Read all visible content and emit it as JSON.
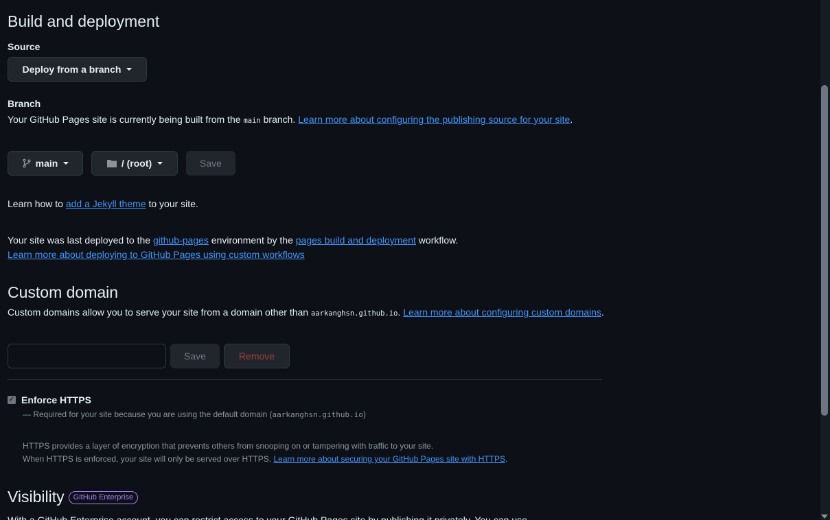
{
  "build": {
    "heading": "Build and deployment",
    "source_label": "Source",
    "source_dropdown": "Deploy from a branch",
    "branch_label": "Branch",
    "branch_desc_pre": "Your GitHub Pages site is currently being built from the ",
    "branch_desc_code": "main",
    "branch_desc_mid": " branch. ",
    "branch_desc_link": "Learn more about configuring the publishing source for your site",
    "branch_desc_end": ".",
    "branch_button": "main",
    "folder_button": "/ (root)",
    "save_button": "Save",
    "jekyll_pre": "Learn how to ",
    "jekyll_link": "add a Jekyll theme",
    "jekyll_post": " to your site.",
    "deploy_pre": "Your site was last deployed to the ",
    "deploy_env_link": "github-pages",
    "deploy_mid": " environment by the ",
    "deploy_workflow_link": "pages build and deployment",
    "deploy_post": " workflow.",
    "deploy_learn_link": "Learn more about deploying to GitHub Pages using custom workflows"
  },
  "custom_domain": {
    "heading": "Custom domain",
    "desc_pre": "Custom domains allow you to serve your site from a domain other than ",
    "desc_code": "aarkanghsn.github.io",
    "desc_mid": ". ",
    "desc_link": "Learn more about configuring custom domains",
    "desc_end": ".",
    "input_value": "",
    "input_placeholder": "",
    "save_button": "Save",
    "remove_button": "Remove"
  },
  "https": {
    "label": "Enforce HTTPS",
    "checked": true,
    "required_pre": "— Required for your site because you are using the default domain (",
    "required_code": "aarkanghsn.github.io",
    "required_post": ")",
    "info_line1": "HTTPS provides a layer of encryption that prevents others from snooping on or tampering with traffic to your site.",
    "info_line2_pre": "When HTTPS is enforced, your site will only be served over HTTPS. ",
    "info_line2_link": "Learn more about securing your GitHub Pages site with HTTPS",
    "info_line2_end": "."
  },
  "visibility": {
    "heading": "Visibility",
    "badge": "GitHub Enterprise",
    "desc_cut": "With a GitHub Enterprise account, you can restrict access to your GitHub Pages site by publishing it privately. You can use"
  },
  "colors": {
    "background": "#0d1117",
    "link": "#4493f8",
    "badge": "#ab7df8",
    "danger_text": "#a0393b"
  }
}
